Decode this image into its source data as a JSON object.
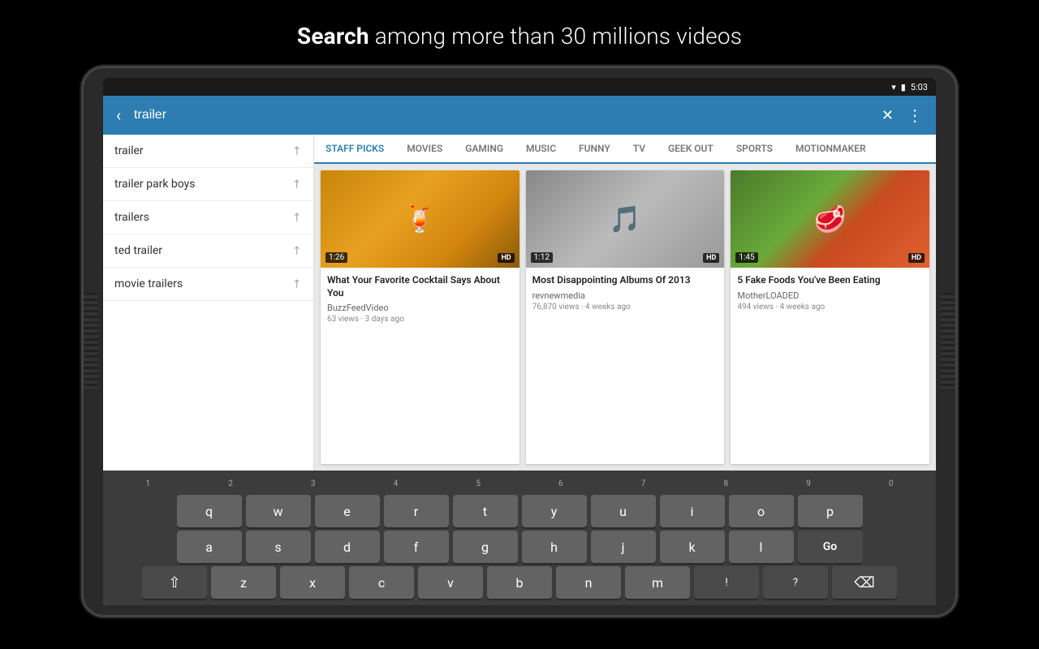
{
  "header": {
    "text_normal": "among more than 30 millions videos",
    "text_bold": "Search"
  },
  "status_bar": {
    "time": "5:03",
    "wifi_icon": "wifi",
    "battery_icon": "battery"
  },
  "app_bar": {
    "back_label": "‹",
    "search_value": "trailer",
    "clear_label": "✕",
    "more_label": "⋮"
  },
  "suggestions": [
    {
      "text": "trailer",
      "arrow": "↗"
    },
    {
      "text": "trailer park boys",
      "arrow": "↗"
    },
    {
      "text": "trailers",
      "arrow": "↗"
    },
    {
      "text": "ted trailer",
      "arrow": "↗"
    },
    {
      "text": "movie trailers",
      "arrow": "↗"
    }
  ],
  "tabs": [
    {
      "label": "STAFF PICKS",
      "active": true
    },
    {
      "label": "MOVIES",
      "active": false
    },
    {
      "label": "GAMING",
      "active": false
    },
    {
      "label": "MUSIC",
      "active": false
    },
    {
      "label": "FUNNY",
      "active": false
    },
    {
      "label": "TV",
      "active": false
    },
    {
      "label": "GEEK OUT",
      "active": false
    },
    {
      "label": "SPORTS",
      "active": false
    },
    {
      "label": "MOTIONMAKER",
      "active": false
    }
  ],
  "videos": [
    {
      "title": "What Your Favorite Cocktail Says About You",
      "channel": "BuzzFeedVideo",
      "views": "63 views",
      "age": "3 days ago",
      "duration": "1:26",
      "quality": "HD",
      "thumb_class": "thumb-cocktail",
      "thumb_emoji": "🍹"
    },
    {
      "title": "Most Disappointing Albums Of 2013",
      "channel": "revnewmedia",
      "views": "76,870 views",
      "age": "4 weeks ago",
      "duration": "1:12",
      "quality": "HD",
      "thumb_class": "thumb-britney",
      "thumb_emoji": "🎵"
    },
    {
      "title": "5 Fake Foods You've Been Eating",
      "channel": "MotherLOADED",
      "views": "494 views",
      "age": "4 weeks ago",
      "duration": "1:45",
      "quality": "HD",
      "thumb_class": "thumb-food",
      "thumb_emoji": "🥩"
    }
  ],
  "keyboard": {
    "rows": [
      [
        "q",
        "w",
        "e",
        "r",
        "t",
        "y",
        "u",
        "i",
        "o",
        "p"
      ],
      [
        "a",
        "s",
        "d",
        "f",
        "g",
        "h",
        "j",
        "k",
        "l"
      ],
      [
        "z",
        "x",
        "c",
        "v",
        "b",
        "n",
        "m"
      ],
      []
    ],
    "num_row": [
      "1",
      "2",
      "3",
      "4",
      "5",
      "6",
      "7",
      "8",
      "9",
      "0"
    ],
    "backspace": "⌫",
    "go": "Go",
    "shift": "⇧",
    "special_left": "!",
    "special_right": "?"
  }
}
